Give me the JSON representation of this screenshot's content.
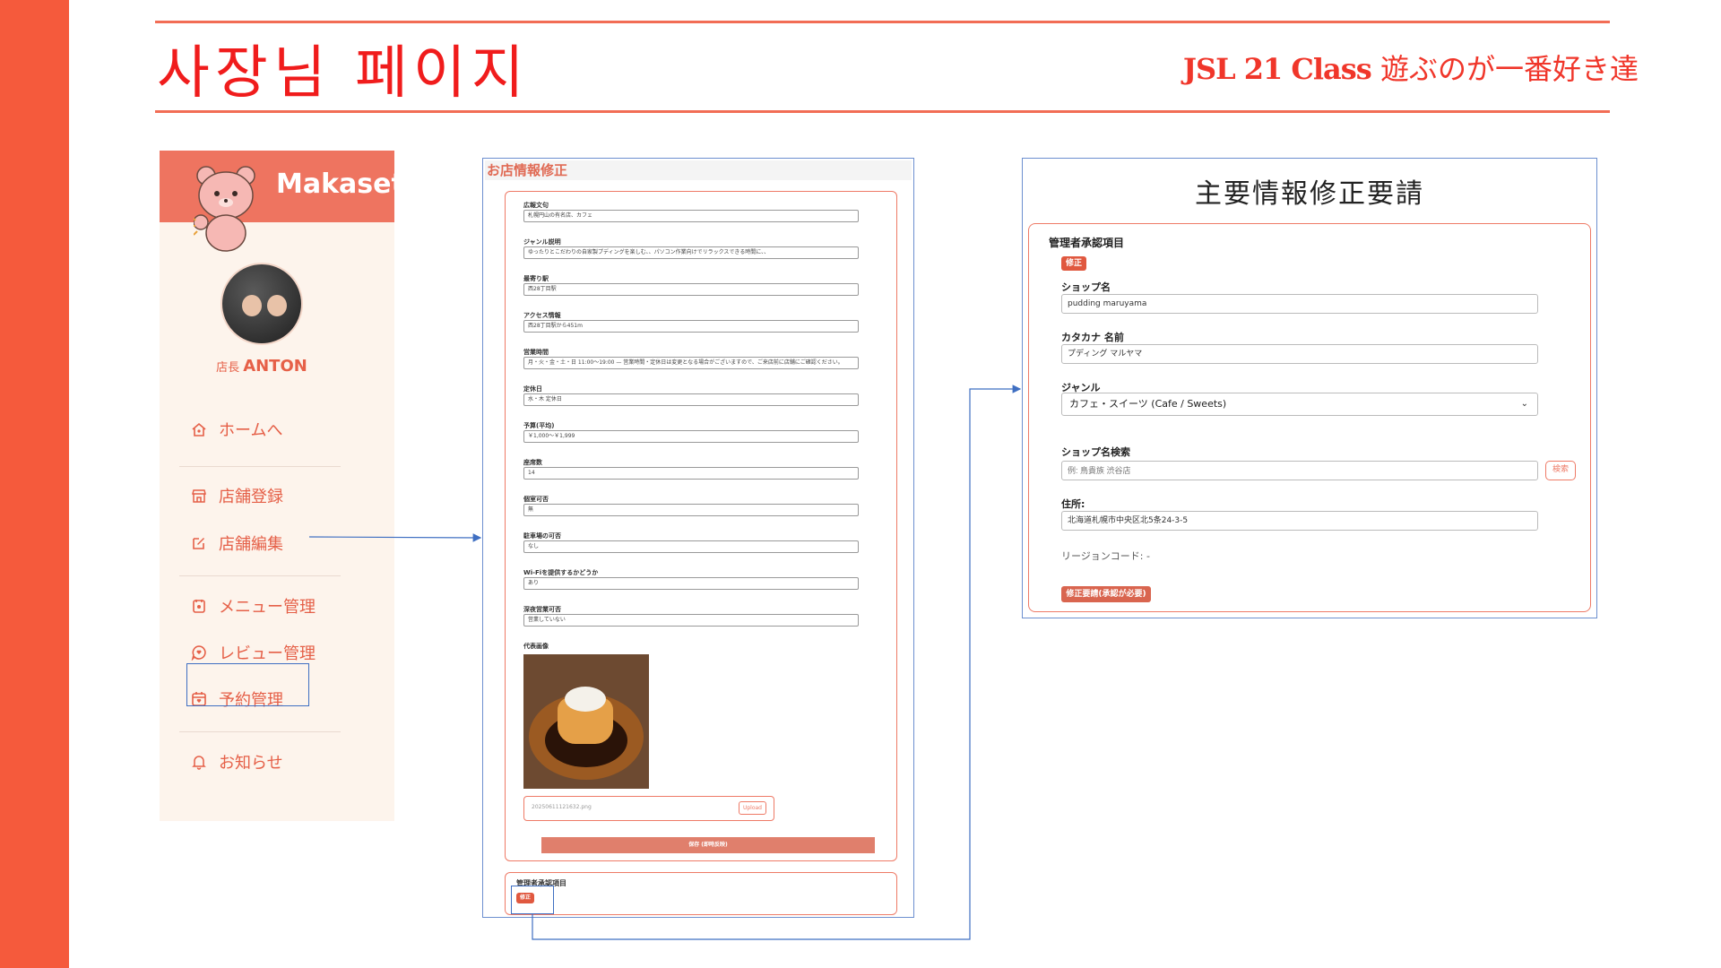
{
  "slide": {
    "title": "사장님 페이지",
    "subtitle_class": "JSL 21 Class",
    "subtitle_jp": " 遊ぶのが一番好き達"
  },
  "colors": {
    "accent": "#f55a3c",
    "sidebar_header": "#ee7460",
    "link": "#3f6fc2",
    "text_accent": "#e55f47"
  },
  "sidebar": {
    "brand": "Makaset",
    "owner_role": "店長",
    "owner_name": "ANTON",
    "items": [
      {
        "label": "ホームへ",
        "icon": "home-icon"
      },
      {
        "label": "店舗登録",
        "icon": "store-icon"
      },
      {
        "label": "店舗編集",
        "icon": "edit-icon"
      },
      {
        "label": "メニュー管理",
        "icon": "menu-icon"
      },
      {
        "label": "レビュー管理",
        "icon": "review-icon"
      },
      {
        "label": "予約管理",
        "icon": "calendar-icon"
      },
      {
        "label": "お知らせ",
        "icon": "bell-icon"
      }
    ]
  },
  "store_form": {
    "title": "お店情報修正",
    "fields": [
      {
        "label": "広報文句",
        "value": "札幌円山の有名店、カフェ"
      },
      {
        "label": "ジャンル説明",
        "value": "ゆったりとこだわりの自家製プディングを楽しむ、、パソコン作業向けでリラックスできる時間に、、"
      },
      {
        "label": "最寄り駅",
        "value": "西28丁目駅"
      },
      {
        "label": "アクセス情報",
        "value": "西28丁目駅から451m"
      },
      {
        "label": "営業時間",
        "value": "月・火・金・土・日 11:00～19:00 — 営業時間・定休日は変更となる場合がございますので、ご来店前に店舗にご確認ください。"
      },
      {
        "label": "定休日",
        "value": "水・木 定休日"
      },
      {
        "label": "予算(平均)",
        "value": "￥1,000～￥1,999"
      },
      {
        "label": "座席数",
        "value": "14"
      },
      {
        "label": "個室可否",
        "value": "無"
      },
      {
        "label": "駐車場の可否",
        "value": "なし"
      },
      {
        "label": "Wi-Fiを提供するかどうか",
        "value": "あり"
      },
      {
        "label": "深夜営業可否",
        "value": "営業していない"
      }
    ],
    "photo_label": "代表画像",
    "photo_filename": "20250611121632.png",
    "upload_label": "Upload",
    "save_label": "保存 (即時反映)",
    "admin_label": "管理者承認項目",
    "admin_edit_label": "修正"
  },
  "request_panel": {
    "title": "主要情報修正要請",
    "section_label": "管理者承認項目",
    "edit_label": "修正",
    "shop_name_label": "ショップ名",
    "shop_name_value": "pudding maruyama",
    "katakana_label": "カタカナ 名前",
    "katakana_value": "プディング マルヤマ",
    "genre_label": "ジャンル",
    "genre_value": "カフェ・スイーツ (Cafe / Sweets)",
    "search_label": "ショップ名検索",
    "search_placeholder": "例: 鳥貴族 渋谷店",
    "search_button": "検索",
    "address_label": "住所:",
    "address_value": "北海道札幌市中央区北5条24-3-5",
    "region_label": "リージョンコード: -",
    "submit_label": "修正要請(承認が必要)"
  }
}
